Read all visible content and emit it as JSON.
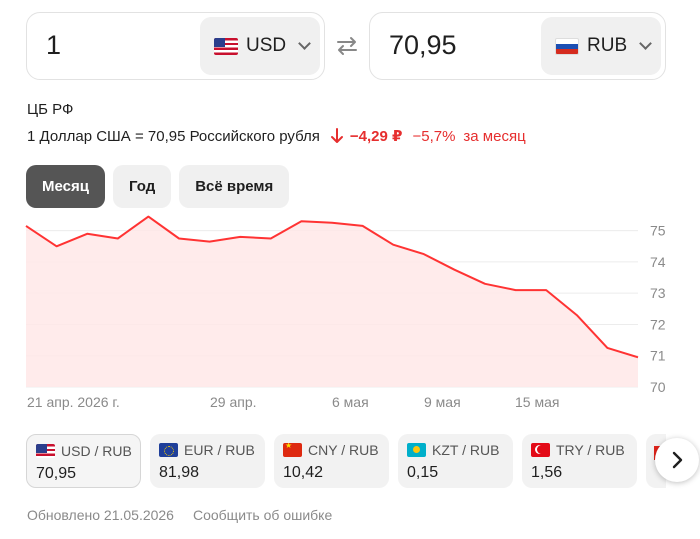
{
  "converter": {
    "from_value": "1",
    "from_currency": "USD",
    "to_value": "70,95",
    "to_currency": "RUB",
    "icons": {
      "swap": "swap-arrows-icon",
      "chevron": "chevron-down-icon"
    }
  },
  "rate": {
    "source": "ЦБ РФ",
    "description": "1 Доллар США = 70,95 Российского рубля",
    "change": "−4,29 ₽",
    "change_percent": "−5,7%",
    "period": "за месяц",
    "change_color": "#e62e2e"
  },
  "tabs": [
    {
      "label": "Месяц",
      "active": true
    },
    {
      "label": "Год",
      "active": false
    },
    {
      "label": "Всё время",
      "active": false
    }
  ],
  "chart_data": {
    "type": "area",
    "x_tick_labels": [
      "21 апр. 2026 г.",
      "29 апр.",
      "6 мая",
      "9 мая",
      "15 мая"
    ],
    "y_ticks": [
      70,
      71,
      72,
      73,
      74,
      75
    ],
    "ylim": [
      70,
      75.5
    ],
    "series": [
      {
        "values": [
          75.15,
          74.5,
          74.9,
          74.75,
          75.45,
          74.75,
          74.65,
          74.8,
          74.75,
          75.3,
          75.25,
          75.15,
          74.55,
          74.25,
          73.75,
          73.3,
          73.1,
          73.1,
          72.3,
          71.25,
          70.95
        ]
      }
    ],
    "line_color": "#ff3333",
    "fill_color": "#ffe8e8",
    "grid": true
  },
  "pairs": [
    {
      "label": "USD / RUB",
      "value": "70,95",
      "flag": "flag-us",
      "active": true
    },
    {
      "label": "EUR / RUB",
      "value": "81,98",
      "flag": "flag-eu",
      "active": false
    },
    {
      "label": "CNY / RUB",
      "value": "10,42",
      "flag": "flag-cn",
      "active": false
    },
    {
      "label": "KZT / RUB",
      "value": "0,15",
      "flag": "flag-kz",
      "active": false
    },
    {
      "label": "TRY / RUB",
      "value": "1,56",
      "flag": "flag-tr",
      "active": false
    }
  ],
  "footer": {
    "updated": "Обновлено 21.05.2026",
    "report": "Сообщить об ошибке"
  }
}
